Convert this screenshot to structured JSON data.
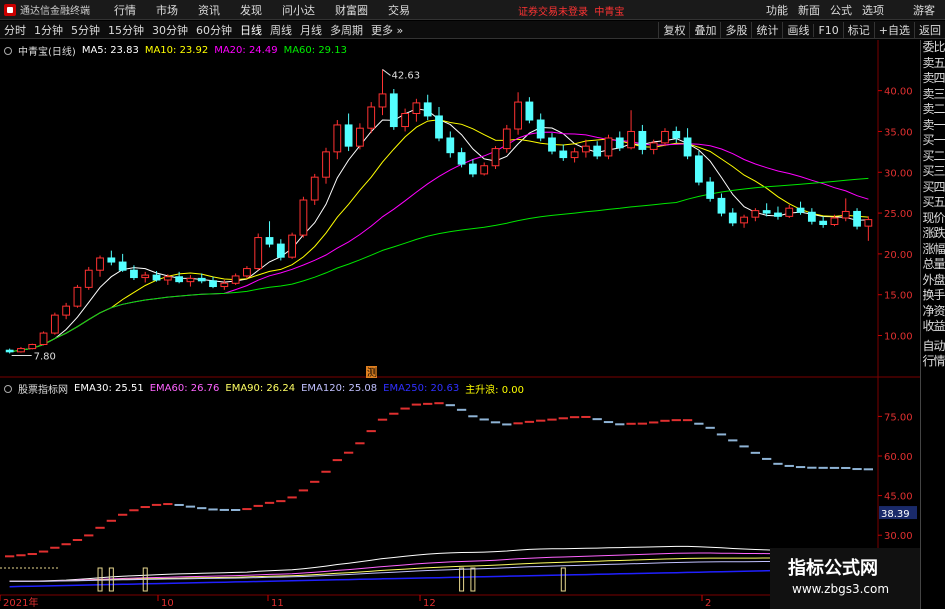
{
  "app": {
    "title": "通达信金融终端",
    "menu": [
      "行情",
      "市场",
      "资讯",
      "发现",
      "问小达",
      "财富圈",
      "交易"
    ],
    "notice": "证券交易未登录",
    "stock_tag": "中青宝",
    "top_right": [
      "功能",
      "新面",
      "公式",
      "选项"
    ],
    "guest": "游客"
  },
  "periods": [
    "分时",
    "1分钟",
    "5分钟",
    "15分钟",
    "30分钟",
    "60分钟",
    "日线",
    "周线",
    "月线",
    "多周期",
    "更多"
  ],
  "active_period": "日线",
  "tools": [
    "复权",
    "叠加",
    "多股",
    "统计",
    "画线",
    "F10",
    "标记",
    "+自选",
    "返回"
  ],
  "main_legend": {
    "name": "中青宝(日线)",
    "ma5": "MA5: 23.83",
    "ma10": "MA10: 23.92",
    "ma20": "MA20: 24.49",
    "ma60": "MA60: 29.13"
  },
  "indicator_legend": {
    "name": "股票指标网",
    "ema30": "EMA30: 25.51",
    "ema60": "EMA60: 26.76",
    "ema90": "EMA90: 26.24",
    "ema120": "EMA120: 25.08",
    "ema250": "EMA250: 20.63",
    "zsz": "主升浪: 0.00"
  },
  "markers": {
    "high": "42.63",
    "low": "7.80",
    "current_ind": "38.39",
    "event": "测"
  },
  "price_axis": [
    "40.00",
    "35.00",
    "30.00",
    "25.00",
    "20.00",
    "15.00",
    "10.00"
  ],
  "ind_axis": [
    "75.00",
    "60.00",
    "45.00",
    "30.00"
  ],
  "date_axis": [
    "2021年",
    "10",
    "11",
    "12",
    "2"
  ],
  "sidebar": [
    "委比",
    "卖五",
    "卖四",
    "卖三",
    "卖二",
    "卖一",
    "买一",
    "买二",
    "买三",
    "买四",
    "买五",
    "现价",
    "涨跌",
    "涨幅",
    "总量",
    "外盘",
    "换手",
    "净资",
    "收益",
    "自动",
    "行情"
  ],
  "watermark": {
    "title": "指标公式网",
    "url": "www.zbgs3.com"
  },
  "colors": {
    "up": "#ff3232",
    "down": "#54ffff",
    "ma5": "#ffffff",
    "ma10": "#ffff00",
    "ma20": "#ff00ff",
    "ma60": "#00e600",
    "ema30": "#ffffff",
    "ema60": "#ff64ff",
    "ema90": "#ffff64",
    "ema120": "#c0c0ff",
    "ema250": "#2020ff"
  },
  "chart_data": {
    "type": "candlestick",
    "price_range": [
      7.0,
      44.0
    ],
    "ohlc": [
      [
        8.2,
        8.4,
        7.8,
        8.0
      ],
      [
        8.0,
        8.6,
        7.9,
        8.4
      ],
      [
        8.4,
        9.0,
        8.3,
        8.9
      ],
      [
        8.9,
        10.5,
        8.8,
        10.3
      ],
      [
        10.3,
        12.8,
        10.1,
        12.5
      ],
      [
        12.5,
        14.0,
        12.0,
        13.6
      ],
      [
        13.6,
        16.2,
        13.4,
        15.9
      ],
      [
        15.9,
        18.4,
        15.6,
        18.0
      ],
      [
        18.0,
        19.8,
        17.2,
        19.5
      ],
      [
        19.5,
        20.4,
        18.6,
        19.0
      ],
      [
        19.0,
        20.0,
        17.8,
        18.0
      ],
      [
        18.0,
        18.6,
        16.8,
        17.1
      ],
      [
        17.1,
        17.8,
        16.5,
        17.4
      ],
      [
        17.4,
        17.9,
        16.6,
        16.8
      ],
      [
        16.8,
        17.5,
        16.2,
        17.2
      ],
      [
        17.2,
        17.8,
        16.4,
        16.6
      ],
      [
        16.6,
        17.4,
        16.0,
        17.0
      ],
      [
        17.0,
        17.6,
        16.4,
        16.7
      ],
      [
        16.7,
        17.2,
        15.8,
        16.0
      ],
      [
        16.0,
        16.8,
        15.6,
        16.4
      ],
      [
        16.4,
        17.6,
        16.2,
        17.3
      ],
      [
        17.3,
        18.5,
        17.0,
        18.2
      ],
      [
        18.2,
        22.5,
        18.0,
        22.0
      ],
      [
        22.0,
        24.0,
        20.8,
        21.2
      ],
      [
        21.2,
        21.8,
        19.2,
        19.6
      ],
      [
        19.6,
        22.6,
        19.4,
        22.3
      ],
      [
        22.3,
        27.0,
        22.0,
        26.6
      ],
      [
        26.6,
        29.8,
        26.0,
        29.4
      ],
      [
        29.4,
        33.0,
        28.6,
        32.5
      ],
      [
        32.5,
        36.4,
        31.6,
        35.8
      ],
      [
        35.8,
        37.2,
        32.6,
        33.2
      ],
      [
        33.2,
        36.0,
        32.8,
        35.4
      ],
      [
        35.4,
        38.6,
        34.8,
        38.0
      ],
      [
        38.0,
        42.6,
        37.0,
        39.6
      ],
      [
        39.6,
        40.2,
        35.2,
        35.6
      ],
      [
        35.6,
        37.8,
        35.0,
        37.2
      ],
      [
        37.2,
        39.0,
        36.2,
        38.5
      ],
      [
        38.5,
        39.5,
        36.4,
        36.9
      ],
      [
        36.9,
        38.0,
        33.8,
        34.2
      ],
      [
        34.2,
        35.0,
        31.8,
        32.4
      ],
      [
        32.4,
        33.0,
        30.6,
        31.0
      ],
      [
        31.0,
        31.6,
        29.4,
        29.8
      ],
      [
        29.8,
        31.2,
        29.6,
        30.8
      ],
      [
        30.8,
        33.2,
        30.4,
        32.9
      ],
      [
        32.9,
        35.8,
        32.4,
        35.3
      ],
      [
        35.3,
        39.8,
        34.6,
        38.6
      ],
      [
        38.6,
        39.2,
        36.0,
        36.4
      ],
      [
        36.4,
        37.2,
        33.8,
        34.2
      ],
      [
        34.2,
        34.8,
        32.2,
        32.6
      ],
      [
        32.6,
        33.4,
        31.4,
        31.8
      ],
      [
        31.8,
        33.0,
        31.2,
        32.5
      ],
      [
        32.5,
        34.0,
        31.8,
        33.2
      ],
      [
        33.2,
        33.8,
        31.6,
        32.0
      ],
      [
        32.0,
        34.6,
        31.6,
        34.2
      ],
      [
        34.2,
        35.0,
        32.6,
        33.0
      ],
      [
        33.0,
        37.6,
        32.8,
        35.0
      ],
      [
        35.0,
        35.8,
        32.2,
        32.8
      ],
      [
        32.8,
        34.0,
        32.2,
        33.6
      ],
      [
        33.6,
        35.4,
        33.2,
        35.0
      ],
      [
        35.0,
        35.6,
        33.6,
        34.2
      ],
      [
        34.2,
        35.4,
        31.6,
        32.0
      ],
      [
        32.0,
        32.6,
        28.4,
        28.8
      ],
      [
        28.8,
        29.4,
        26.4,
        26.8
      ],
      [
        26.8,
        27.4,
        24.6,
        25.0
      ],
      [
        25.0,
        25.6,
        23.4,
        23.8
      ],
      [
        23.8,
        24.8,
        23.2,
        24.5
      ],
      [
        24.5,
        25.6,
        24.0,
        25.3
      ],
      [
        25.3,
        26.2,
        24.6,
        25.0
      ],
      [
        25.0,
        25.8,
        24.2,
        24.6
      ],
      [
        24.6,
        26.0,
        24.4,
        25.6
      ],
      [
        25.6,
        26.4,
        24.8,
        25.1
      ],
      [
        25.1,
        25.6,
        23.6,
        24.0
      ],
      [
        24.0,
        24.6,
        23.2,
        23.6
      ],
      [
        23.6,
        24.8,
        23.4,
        24.4
      ],
      [
        24.4,
        26.8,
        24.0,
        25.2
      ],
      [
        25.2,
        25.6,
        23.0,
        23.4
      ],
      [
        23.4,
        24.6,
        21.6,
        24.2
      ]
    ],
    "ind_range": [
      10.0,
      85.0
    ]
  }
}
